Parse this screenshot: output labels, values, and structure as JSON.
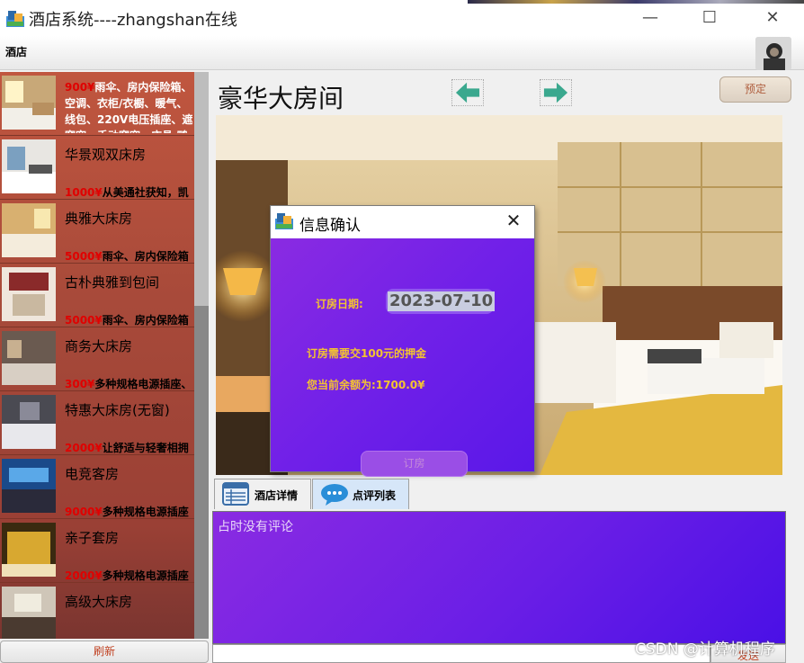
{
  "window": {
    "title": "酒店系统----zhangshan在线",
    "min_glyph": "—",
    "max_glyph": "☐",
    "close_glyph": "✕"
  },
  "menu": {
    "hotel": "酒店"
  },
  "room_list": {
    "items": [
      {
        "name": "",
        "price": "900¥",
        "desc": "雨伞、房内保险箱、空调、衣柜/衣橱、暖气、线包、220V电压插座、遮窗帘、手动窗帘、床具:鸭"
      },
      {
        "name": "华景观双床房",
        "price": "1000¥",
        "desc": "从美通社获知，凯"
      },
      {
        "name": "典雅大床房",
        "price": "5000¥",
        "desc": "雨伞、房内保险箱"
      },
      {
        "name": "古朴典雅到包间",
        "price": "5000¥",
        "desc": "雨伞、房内保险箱"
      },
      {
        "name": "商务大床房",
        "price": "300¥",
        "desc": "多种规格电源插座、"
      },
      {
        "name": "特惠大床房(无窗)",
        "price": "2000¥",
        "desc": "让舒适与轻奢相拥"
      },
      {
        "name": "电竞客房",
        "price": "9000¥",
        "desc": "多种规格电源插座"
      },
      {
        "name": "亲子套房",
        "price": "2000¥",
        "desc": "多种规格电源插座"
      },
      {
        "name": "高级大床房",
        "price": "",
        "desc": ""
      }
    ],
    "refresh_label": "刷新"
  },
  "detail": {
    "room_title": "豪华大房间",
    "book_label": "预定"
  },
  "dialog": {
    "title": "信息确认",
    "close_glyph": "✕",
    "date_label": "订房日期:",
    "date_value": "2023-07-10",
    "deposit_note": "订房需要交100元的押金",
    "balance_note": "您当前余额为:1700.0¥",
    "book_label": "订房"
  },
  "tabs": [
    {
      "label": "酒店详情"
    },
    {
      "label": "点评列表"
    }
  ],
  "reviews": {
    "empty_text": "占时没有评论",
    "send_label": "发送"
  },
  "watermark": "CSDN @计算机程序",
  "colors": {
    "list_bg": "#a84a3a",
    "price_red": "#e00000",
    "dialog_purple": "#7020e8",
    "note_yellow": "#f4c430",
    "arrow_teal": "#3aa88e"
  }
}
